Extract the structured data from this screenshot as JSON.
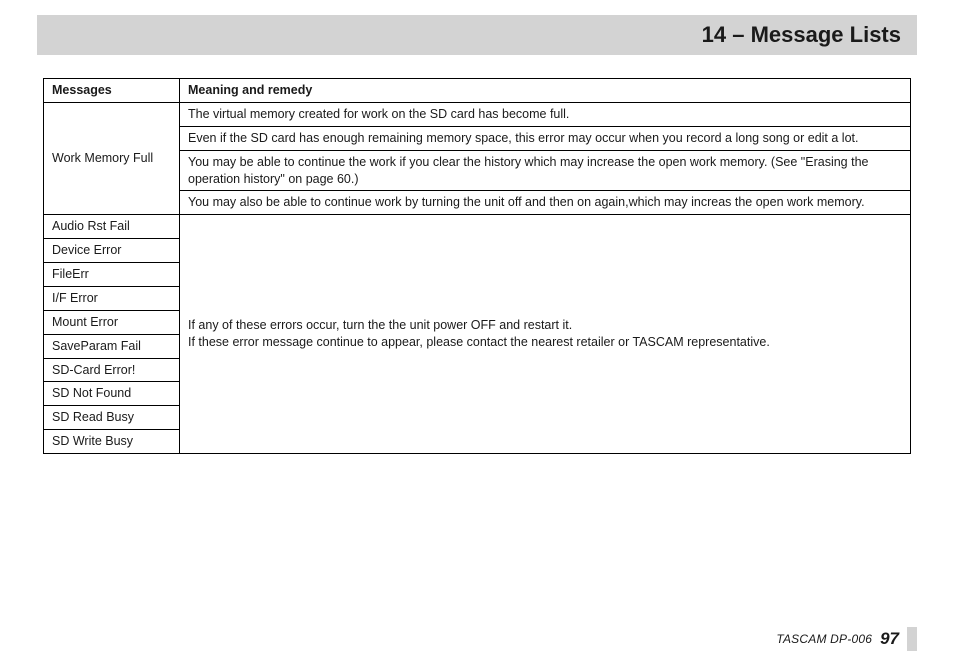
{
  "header": {
    "title": "14 – Message Lists"
  },
  "table": {
    "headers": {
      "c1": "Messages",
      "c2": "Meaning and remedy"
    },
    "row1": {
      "msg": "Work Memory Full",
      "p1": "The virtual memory created for work on the SD card has become full.",
      "p2": "Even if the SD card has enough remaining memory space, this error may occur when you record a long song or edit a lot.",
      "p3": "You may be able to continue the work if you clear the history which may increase the open work memory. (See \"Erasing the operation history\" on page 60.)",
      "p4": "You may also be able to continue work by turning the unit off and then on again,which may increas the open work memory."
    },
    "group": {
      "msgs": [
        "Audio Rst Fail",
        "Device Error",
        "FileErr",
        "I/F Error",
        "Mount Error",
        "SaveParam Fail",
        "SD-Card Error!",
        "SD Not Found",
        "SD Read Busy",
        "SD Write Busy"
      ],
      "p1": "If any of these errors occur, turn the the unit power OFF and restart it.",
      "p2": "If these error message continue to appear, please contact the nearest retailer or TASCAM representative."
    }
  },
  "footer": {
    "label": "TASCAM  DP-006",
    "page": "97"
  }
}
